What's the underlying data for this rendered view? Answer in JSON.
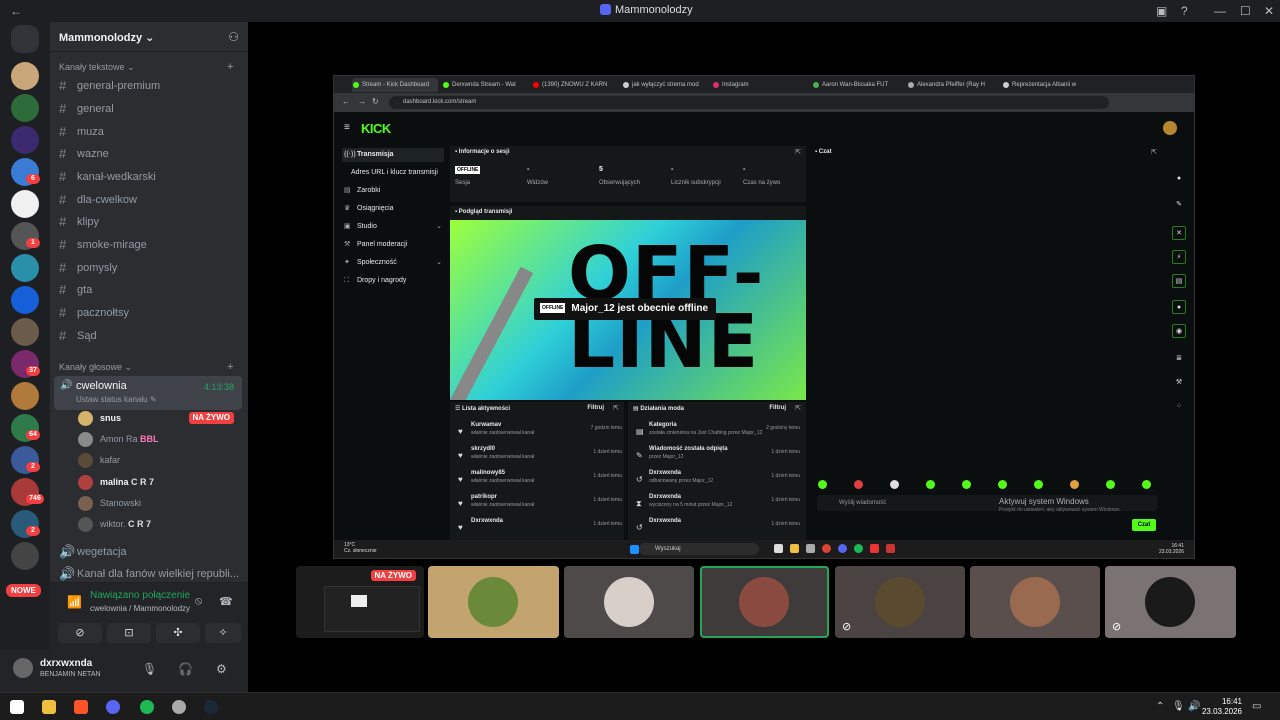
{
  "window": {
    "title": "Mammonolodzy"
  },
  "server_badges": [
    "6",
    "1",
    "37",
    "64",
    "2",
    "746",
    "2"
  ],
  "nowe": "NOWE",
  "guild": {
    "name": "Mammonolodzy"
  },
  "text_category": "Kanały tekstowe",
  "text_channels": [
    "general-premium",
    "general",
    "muza",
    "wazne",
    "kanał-wedkarski",
    "dla-cwelkow",
    "klipy",
    "smoke-mirage",
    "pomysly",
    "gta",
    "pacznołtsy",
    "Sąd"
  ],
  "voice_category": "Kanały głosowe",
  "voice_channel": {
    "name": "cwelownia",
    "time": "4:13:38",
    "status": "Ustaw status kanału"
  },
  "voice_users": [
    {
      "name": "snus",
      "live": "NA ŻYWO"
    },
    {
      "name": "Amon Ra",
      "tag": "BBL"
    },
    {
      "name": "kafar"
    },
    {
      "name": "malina",
      "tag": "C R 7"
    },
    {
      "name": "Stanowski"
    },
    {
      "name": "wiktor.",
      "tag": "C R 7"
    }
  ],
  "more_channels": [
    "wegetacja",
    "Kanał dla fanów wielkiej republi..."
  ],
  "voice_panel": {
    "status": "Nawiązano połączenie",
    "sub": "cwelownia / Mammonolodzy"
  },
  "user_panel": {
    "name": "dxrxwxnda",
    "status": "BENJAMIN NETAN"
  },
  "browser": {
    "tabs": [
      "Stream - Kick Dashboard",
      "Derxwnda Stream - Wat",
      "(1390) ZNOWU Z KARN",
      "jak wyłączyć strema mod",
      "Instagram",
      "Aaron Wan-Bissaka FUT",
      "Alexandra Pfeiffer (Ray H",
      "Reprezentacja Albanii w"
    ],
    "url": "dashboard.kick.com/stream"
  },
  "kick": {
    "logo": "KICK",
    "nav": [
      {
        "label": "Transmisja"
      },
      {
        "label": "Adres URL i klucz transmisji"
      },
      {
        "label": "Zarobki"
      },
      {
        "label": "Osiągnięcia"
      },
      {
        "label": "Studio"
      },
      {
        "label": "Panel moderacji"
      },
      {
        "label": "Społeczność"
      },
      {
        "label": "Dropy i nagrody"
      }
    ],
    "session": {
      "title": "Informacje o sesji",
      "offline": "OFFLINE",
      "stats": [
        {
          "value": "",
          "label": "Sesja"
        },
        {
          "value": "-",
          "label": "Widzów"
        },
        {
          "value": "5",
          "label": "Obserwujących"
        },
        {
          "value": "-",
          "label": "Licznik subskrypcji"
        },
        {
          "value": "-",
          "label": "Czas na żywo"
        }
      ]
    },
    "preview": {
      "title": "Podgląd transmisji",
      "big1": "OFF-",
      "big2": "LINE",
      "badge": "OFFLINE",
      "message": "Major_12 jest obecnie offline"
    },
    "activity": {
      "title": "Lista aktywności",
      "filter": "Filtruj",
      "items": [
        {
          "name": "Kurwamav",
          "sub": "właśnie zaobserwował kanał",
          "time": "7 godzin temu"
        },
        {
          "name": "skrzydl0",
          "sub": "właśnie zaobserwował kanał",
          "time": "1 dzień temu"
        },
        {
          "name": "malinowy85",
          "sub": "właśnie zaobserwował kanał",
          "time": "1 dzień temu"
        },
        {
          "name": "patrikopr",
          "sub": "właśnie zaobserwował kanał",
          "time": "1 dzień temu"
        },
        {
          "name": "Dxrxwxnda",
          "sub": "",
          "time": "1 dzień temu"
        }
      ]
    },
    "mod": {
      "title": "Działania moda",
      "filter": "Filtruj",
      "items": [
        {
          "name": "Kategoria",
          "sub": "została zmieniona na Just Chatting przez Major_12",
          "time": "2 godziny temu"
        },
        {
          "name": "Wiadomość została odpięta",
          "sub": "przez Major_12",
          "time": "1 dzień temu"
        },
        {
          "name": "Dxrxwxnda",
          "sub": "odbanowany przez Major_12",
          "time": "1 dzień temu"
        },
        {
          "name": "Dxrxwxnda",
          "sub": "wyciszony na 5 minut przez Major_12",
          "time": "1 dzień temu"
        },
        {
          "name": "Dxrxwxnda",
          "sub": "",
          "time": "1 dzień temu"
        }
      ]
    },
    "chat": {
      "title": "Czat",
      "placeholder": "Wyślij wiadomość",
      "send": "Czat"
    },
    "windows_activation": {
      "title": "Aktywuj system Windows",
      "sub": "Przejdź do ustawień, aby aktywować system Windows."
    }
  },
  "remote_taskbar": {
    "weather": "13°C",
    "weather_sub": "Cz. słonecznie",
    "search": "Wyszukaj",
    "time": "16:41",
    "date": "23.03.2026"
  },
  "tiles": {
    "live": "NA ŻYWO"
  },
  "taskbar": {
    "time": "16:41",
    "date": "23.03.2026"
  }
}
